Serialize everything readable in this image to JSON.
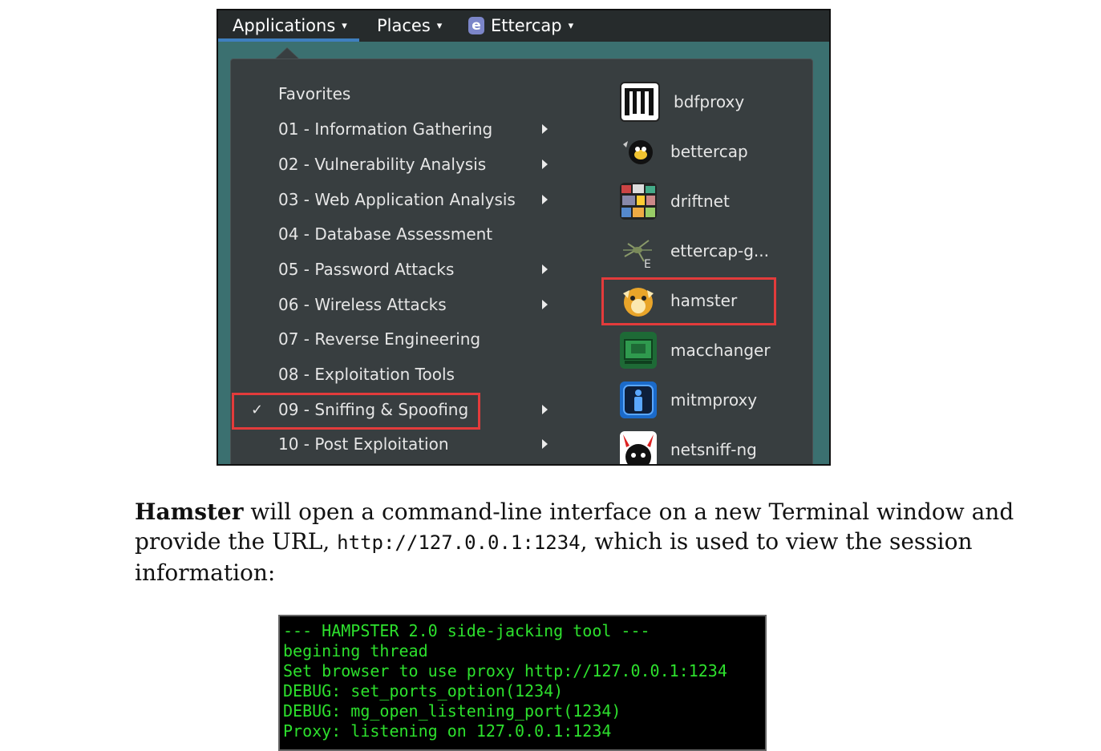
{
  "topbar": {
    "applications_label": "Applications",
    "places_label": "Places",
    "ettercap_label": "Ettercap",
    "ettercap_icon_glyph": "e",
    "caret_glyph": "▾"
  },
  "menu": {
    "check_glyph": "✓",
    "categories": [
      {
        "label": "Favorites",
        "has_submenu": false
      },
      {
        "label": "01 - Information Gathering",
        "has_submenu": true
      },
      {
        "label": "02 - Vulnerability Analysis",
        "has_submenu": true
      },
      {
        "label": "03 - Web Application Analysis",
        "has_submenu": true
      },
      {
        "label": "04 - Database Assessment",
        "has_submenu": false
      },
      {
        "label": "05 - Password Attacks",
        "has_submenu": true
      },
      {
        "label": "06 - Wireless Attacks",
        "has_submenu": true
      },
      {
        "label": "07 - Reverse Engineering",
        "has_submenu": false
      },
      {
        "label": "08 - Exploitation Tools",
        "has_submenu": false
      },
      {
        "label": "09 - Sniffing & Spoofing",
        "has_submenu": true,
        "selected": true
      },
      {
        "label": "10 - Post Exploitation",
        "has_submenu": true
      }
    ],
    "tools": [
      {
        "label": "bdfproxy",
        "icon": "bdfproxy-icon"
      },
      {
        "label": "bettercap",
        "icon": "bettercap-icon"
      },
      {
        "label": "driftnet",
        "icon": "driftnet-icon"
      },
      {
        "label": "ettercap-g...",
        "icon": "ettercap-graphical-icon"
      },
      {
        "label": "hamster",
        "icon": "hamster-icon",
        "highlighted": true
      },
      {
        "label": "macchanger",
        "icon": "macchanger-icon"
      },
      {
        "label": "mitmproxy",
        "icon": "mitmproxy-icon"
      },
      {
        "label": "netsniff-ng",
        "icon": "netsniff-ng-icon"
      }
    ]
  },
  "paragraph": {
    "bold": "Hamster",
    "part1": " will open a command-line interface on a new Terminal window and provide the URL, ",
    "url": "http://127.0.0.1:1234",
    "part2": ", which is used to view the session information:"
  },
  "terminal": {
    "lines": [
      "--- HAMPSTER 2.0 side-jacking tool ---",
      "begining thread",
      "Set browser to use proxy http://127.0.0.1:1234",
      "DEBUG: set_ports_option(1234)",
      "DEBUG: mg_open_listening_port(1234)",
      "Proxy: listening on 127.0.0.1:1234"
    ]
  },
  "colors": {
    "highlight": "#e33b3b",
    "terminal_text": "#2de02d",
    "menu_bg": "#383e40",
    "topbar_bg": "#262b2c"
  }
}
